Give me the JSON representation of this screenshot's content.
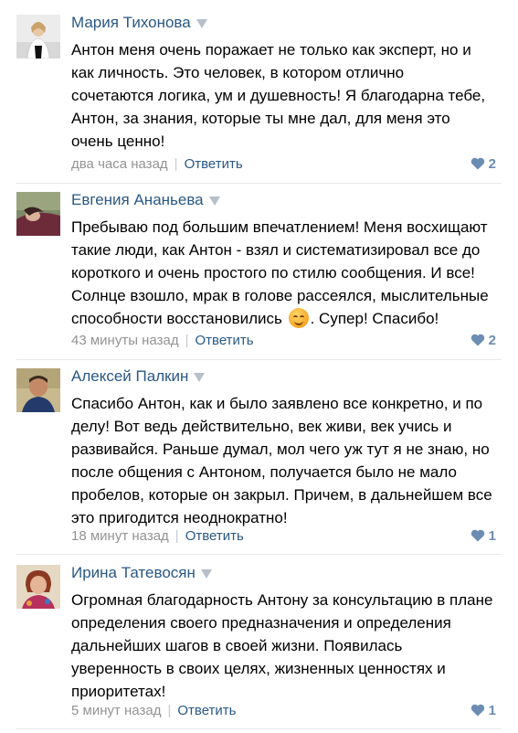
{
  "colors": {
    "name": "#2a5885",
    "meta": "#939393",
    "reply": "#2a5885",
    "like": "#6b8db3",
    "divider": "#e7e8ec"
  },
  "comments": [
    {
      "author": "Мария Тихонова",
      "lines": [
        "Антон меня очень поражает не только как эксперт, но и",
        "как личность. Это человек, в котором отлично",
        "сочетаются логика, ум и душевность! Я благодарна тебе,",
        "Антон, за знания, которые ты мне дал, для меня это",
        "очень ценно!"
      ],
      "time": "два часа назад",
      "reply": "Ответить",
      "likes": "2",
      "icon": "heart-icon"
    },
    {
      "author": "Евгения Ананьева",
      "lines": [
        "Пребываю под большим впечатлением! Меня восхищают",
        "такие люди, как Антон - взял и систематизировал все до",
        "короткого и очень простого по стилю сообщения. И все!",
        "Солнце взошло, мрак в голове рассеялся, мыслительные"
      ],
      "last_line_before": "способности восстановились ",
      "last_line_after": ". Супер! Спасибо!",
      "emoji": "smile-emoji",
      "time": "43 минуты назад",
      "reply": "Ответить",
      "likes": "2",
      "icon": "heart-icon"
    },
    {
      "author": "Алексей Палкин",
      "lines": [
        "Спасибо Антон, как и было заявлено все конкретно, и по",
        "делу! Вот ведь действительно, век живи, век учись и",
        "развивайся. Раньше думал, мол чего уж тут я не знаю, но",
        "после общения с Антоном, получается было не мало",
        "пробелов, которые он закрыл. Причем, в дальнейшем все",
        "это пригодится неоднократно!"
      ],
      "time": "18 минут назад",
      "reply": "Ответить",
      "likes": "1",
      "icon": "heart-icon"
    },
    {
      "author": "Ирина Татевосян",
      "lines": [
        "Огромная благодарность Антону за консультацию в плане",
        "определения своего предназначения и определения",
        "дальнейших шагов в своей жизни. Появилась",
        "уверенность в своих целях, жизненных ценностях и",
        "приоритетах!"
      ],
      "time": "5 минут назад",
      "reply": "Ответить",
      "likes": "1",
      "icon": "heart-icon"
    }
  ]
}
